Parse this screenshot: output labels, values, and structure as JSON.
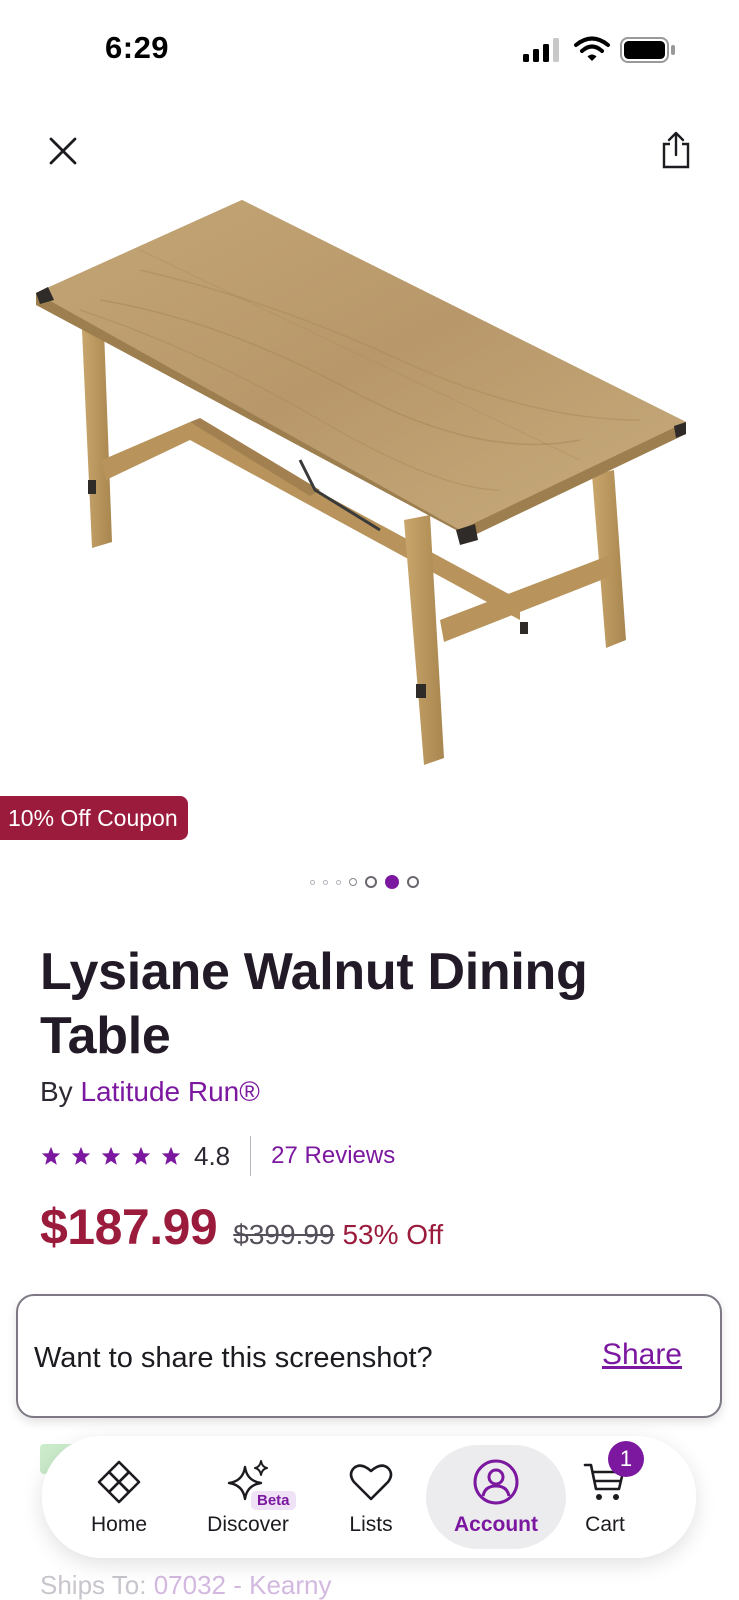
{
  "status_bar": {
    "time": "6:29",
    "icons": [
      "cellular-signal-icon",
      "wifi-icon",
      "battery-icon"
    ]
  },
  "header": {
    "close_icon": "close-icon",
    "share_icon": "share-icon"
  },
  "product": {
    "image_alt": "wooden dining table",
    "coupon_badge": "10% Off Coupon",
    "carousel": {
      "total": 6,
      "active_index": 4
    },
    "title": "Lysiane Walnut Dining Table",
    "brand_prefix": "By ",
    "brand": "Latitude Run®",
    "rating_value": "4.8",
    "rating_stars": 5,
    "reviews_link": "27 Reviews",
    "price_current": "$187.99",
    "price_original": "$399.99",
    "price_discount": "53% Off"
  },
  "share_prompt": {
    "text": "Want to share this screenshot?",
    "link": "Share"
  },
  "below_fold": {
    "ships_to_label": "Ships To: ",
    "ships_to_zip": "07032 - Kearny"
  },
  "bottom_nav": {
    "items": [
      {
        "label": "Home",
        "icon": "home-icon"
      },
      {
        "label": "Discover",
        "icon": "sparkle-icon",
        "badge": "Beta"
      },
      {
        "label": "Lists",
        "icon": "heart-icon"
      },
      {
        "label": "Account",
        "icon": "account-icon"
      },
      {
        "label": "Cart",
        "icon": "cart-icon",
        "count": "1"
      }
    ],
    "active": "Account"
  },
  "colors": {
    "accent": "#7b189f",
    "price": "#9b1b3d",
    "coupon_bg": "#9b1b3d"
  }
}
